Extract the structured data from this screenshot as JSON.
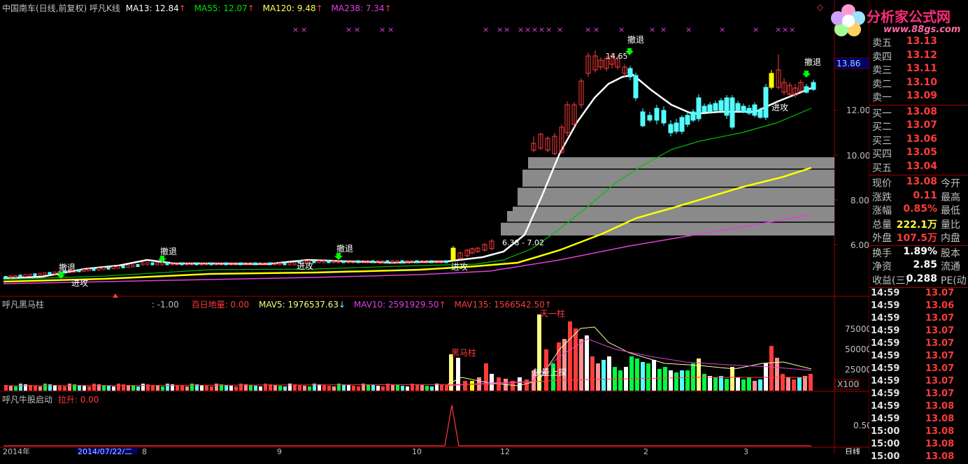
{
  "chart_header": {
    "stock": "中国南车(日线,前复权)",
    "indicator": "呼凡K线",
    "ma13": "MA13: 12.84",
    "ma55": "MA55: 12.07",
    "ma120": "MA120: 9.48",
    "ma238": "MA238: 7.34"
  },
  "volume_header": {
    "title": "呼凡黑马柱",
    "v1": ": -1.00",
    "v2": "百日地量: 0.00",
    "mav5": "MAV5: 1976537.63",
    "mav10": "MAV10: 2591929.50",
    "mav135": "MAV135: 1566542.50"
  },
  "bull_header": {
    "title": "呼凡牛股启动",
    "v1": "拉升: 0.00"
  },
  "annotations": {
    "chetui": "撤退",
    "jingong": "进攻",
    "high_label": "14.65",
    "range_label": "6.38 - 7.02",
    "heima": "黑马柱",
    "tianyizhu": "天一柱",
    "fangliang": "放量上探"
  },
  "price_axis": {
    "current": "13.86",
    "ticks": [
      "12.00",
      "10.00",
      "8.00",
      "6.00"
    ]
  },
  "volume_axis": {
    "ticks": [
      "75000",
      "50000",
      "25000"
    ],
    "unit": "X100"
  },
  "bull_axis": {
    "ticks": [
      "0.50"
    ]
  },
  "date_axis": {
    "labels": [
      "2014年",
      "2014/07/22/二",
      "8",
      "9",
      "10",
      "12",
      "2",
      "3"
    ],
    "period": "日线"
  },
  "logo": {
    "text": "分析家公式网",
    "url": "www.88gs.com"
  },
  "quote": {
    "sell": [
      {
        "label": "卖五",
        "price": "13.13"
      },
      {
        "label": "卖四",
        "price": "13.12"
      },
      {
        "label": "卖三",
        "price": "13.11"
      },
      {
        "label": "卖二",
        "price": "13.10"
      },
      {
        "label": "卖一",
        "price": "13.09"
      }
    ],
    "buy": [
      {
        "label": "买一",
        "price": "13.08"
      },
      {
        "label": "买二",
        "price": "13.07"
      },
      {
        "label": "买三",
        "price": "13.06"
      },
      {
        "label": "买四",
        "price": "13.05"
      },
      {
        "label": "买五",
        "price": "13.04"
      }
    ],
    "stats": [
      {
        "label": "现价",
        "value": "13.08",
        "label2": "今开",
        "color": "#ff3b3b"
      },
      {
        "label": "涨跌",
        "value": "0.11",
        "label2": "最高",
        "color": "#ff3b3b"
      },
      {
        "label": "涨幅",
        "value": "0.85%",
        "label2": "最低",
        "color": "#ff3b3b"
      },
      {
        "label": "总量",
        "value": "222.1万",
        "label2": "量比",
        "color": "#ffff40"
      },
      {
        "label": "外盘",
        "value": "107.5万",
        "label2": "内盘",
        "color": "#ff3b3b"
      },
      {
        "label": "换手",
        "value": "1.89%",
        "label2": "股本",
        "color": "#ffffff"
      },
      {
        "label": "净资",
        "value": "2.85",
        "label2": "流通",
        "color": "#ffffff"
      },
      {
        "label": "收益(三)",
        "value": "0.288",
        "label2": "PE(动",
        "color": "#ffffff"
      }
    ],
    "ticks": [
      {
        "time": "14:59",
        "price": "13.07"
      },
      {
        "time": "14:59",
        "price": "13.06"
      },
      {
        "time": "14:59",
        "price": "13.07"
      },
      {
        "time": "14:59",
        "price": "13.07"
      },
      {
        "time": "14:59",
        "price": "13.07"
      },
      {
        "time": "14:59",
        "price": "13.07"
      },
      {
        "time": "14:59",
        "price": "13.07"
      },
      {
        "time": "14:59",
        "price": "13.07"
      },
      {
        "time": "14:59",
        "price": "13.07"
      },
      {
        "time": "14:59",
        "price": "13.08"
      },
      {
        "time": "14:59",
        "price": "13.08"
      },
      {
        "time": "15:00",
        "price": "13.08"
      },
      {
        "time": "15:00",
        "price": "13.08"
      },
      {
        "time": "15:00",
        "price": "13.08"
      }
    ]
  },
  "colors": {
    "up": "#ff3b3b",
    "down": "#54ffff",
    "ma13": "#ffffff",
    "ma55": "#00c000",
    "ma120": "#ffff00",
    "ma238": "#e040e0",
    "grid": "#800000"
  }
}
